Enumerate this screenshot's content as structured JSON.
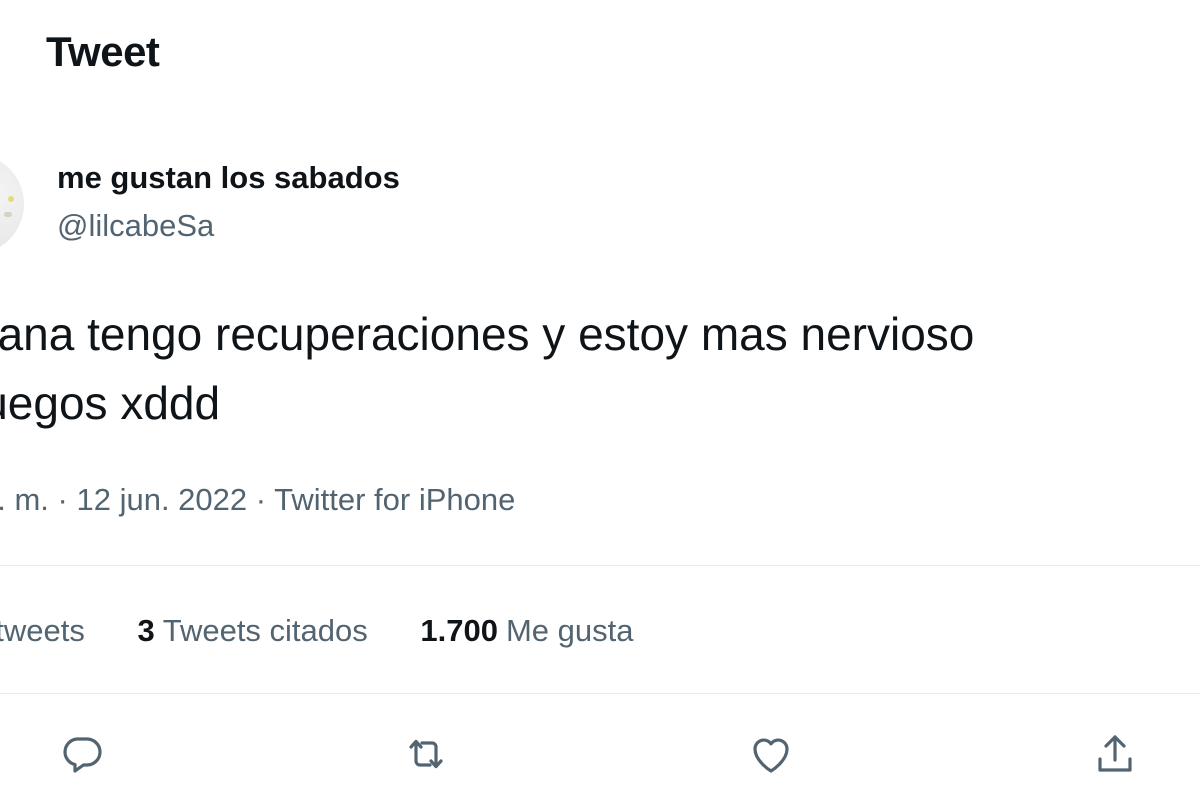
{
  "header": {
    "title": "Tweet"
  },
  "author": {
    "display_name": "me gustan los sabados",
    "handle": "@lilcabeSa"
  },
  "tweet": {
    "text_lines": [
      "ñana tengo recuperaciones y estoy mas nervioso",
      "juegos xddd"
    ]
  },
  "meta": {
    "time": "a. m.",
    "separator1": "·",
    "date": "12 jun. 2022",
    "separator2": "·",
    "source": "Twitter for iPhone"
  },
  "stats": {
    "retweets_label": "etweets",
    "quotes_count": "3",
    "quotes_label": "Tweets citados",
    "likes_count": "1.700",
    "likes_label": "Me gusta"
  },
  "actions": {
    "reply_icon": "reply-icon",
    "retweet_icon": "retweet-icon",
    "like_icon": "heart-icon",
    "share_icon": "share-icon",
    "icon_color": "#536471"
  }
}
